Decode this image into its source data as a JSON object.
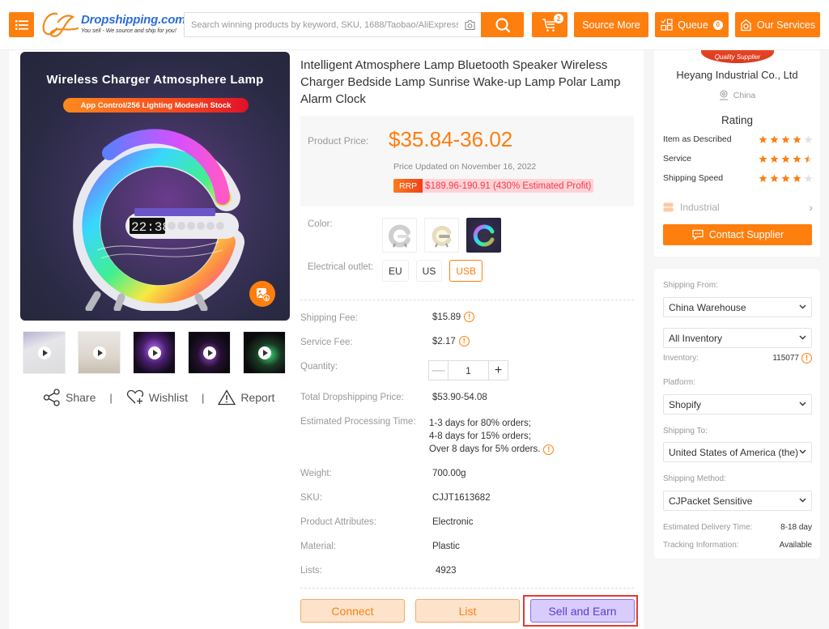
{
  "header": {
    "logo_brand": "Dropshipping.com",
    "logo_tagline": "You sell - We source and ship for you!",
    "search_placeholder": "Search winning products by keyword, SKU, 1688/Taobao/AliExpress URL",
    "cart_count": "2",
    "source_more_label": "Source More",
    "queue_label": "Queue",
    "queue_count": "0",
    "services_label": "Our Services",
    "accent_color": "#fe7e0e"
  },
  "gallery": {
    "main_image_title": "Wireless Charger Atmosphere Lamp",
    "main_image_subtitle": "App Control/256 Lighting Modes/In Stock",
    "clock_text": "22:38",
    "thumbnails": [
      {
        "type": "video",
        "icon": "play-icon"
      },
      {
        "type": "video",
        "icon": "play-icon"
      },
      {
        "type": "video",
        "icon": "play-icon"
      },
      {
        "type": "video",
        "icon": "play-icon"
      },
      {
        "type": "video",
        "icon": "play-icon"
      }
    ],
    "actions": {
      "share": "Share",
      "wishlist": "Wishlist",
      "report": "Report",
      "separator": "|"
    }
  },
  "product": {
    "title": "Intelligent Atmosphere Lamp Bluetooth Speaker Wireless Charger Bedside Lamp Sunrise Wake-up Lamp Polar Lamp Alarm Clock",
    "price_label": "Product Price:",
    "price": "$35.84-36.02",
    "price_updated": "Price Updated on November 16, 2022",
    "rrp_tag": "RRP",
    "rrp_value": "$189.96-190.91 (430% Estimated Profit)",
    "color_label": "Color:",
    "color_options": [
      "white",
      "warm-white",
      "rgb"
    ],
    "outlet_label": "Electrical outlet:",
    "outlet_options": [
      "EU",
      "US",
      "USB"
    ],
    "outlet_selected": "USB",
    "shipping_fee_label": "Shipping Fee:",
    "shipping_fee": "$15.89",
    "service_fee_label": "Service Fee:",
    "service_fee": "$2.17",
    "quantity_label": "Quantity:",
    "quantity": "1",
    "total_label": "Total Dropshipping Price:",
    "total": "$53.90-54.08",
    "processing_label": "Estimated Processing Time:",
    "processing_lines": [
      "1-3 days for 80% orders;",
      "4-8 days for 15% orders;",
      "Over 8 days for 5% orders."
    ],
    "weight_label": "Weight:",
    "weight": "700.00g",
    "sku_label": "SKU:",
    "sku": "CJJT1613682",
    "attributes_label": "Product Attributes:",
    "attributes": "Electronic",
    "material_label": "Material:",
    "material": "Plastic",
    "lists_label": "Lists:",
    "lists": "4923",
    "buttons": {
      "connect": "Connect",
      "list": "List",
      "sell_and_earn": "Sell and Earn"
    }
  },
  "supplier": {
    "badge": "Quality Supplier",
    "name": "Heyang Industrial Co., Ltd",
    "location": "China",
    "rating_title": "Rating",
    "ratings": [
      {
        "label": "Item as Described",
        "stars": 4,
        "max": 5
      },
      {
        "label": "Service",
        "stars": 4.5,
        "max": 5
      },
      {
        "label": "Shipping Speed",
        "stars": 4,
        "max": 5
      }
    ],
    "industry": "Industrial",
    "contact_label": "Contact Supplier"
  },
  "shipping": {
    "from_label": "Shipping From:",
    "from_value": "China Warehouse",
    "inventory_filter": "All Inventory",
    "inventory_label": "Inventory:",
    "inventory_value": "115077",
    "platform_label": "Platform:",
    "platform_value": "Shopify",
    "to_label": "Shipping To:",
    "to_value": "United States of America (the)",
    "method_label": "Shipping Method:",
    "method_value": "CJPacket Sensitive",
    "delivery_label": "Estimated Delivery Time:",
    "delivery_value": "8-18 day",
    "tracking_label": "Tracking Information:",
    "tracking_value": "Available"
  }
}
